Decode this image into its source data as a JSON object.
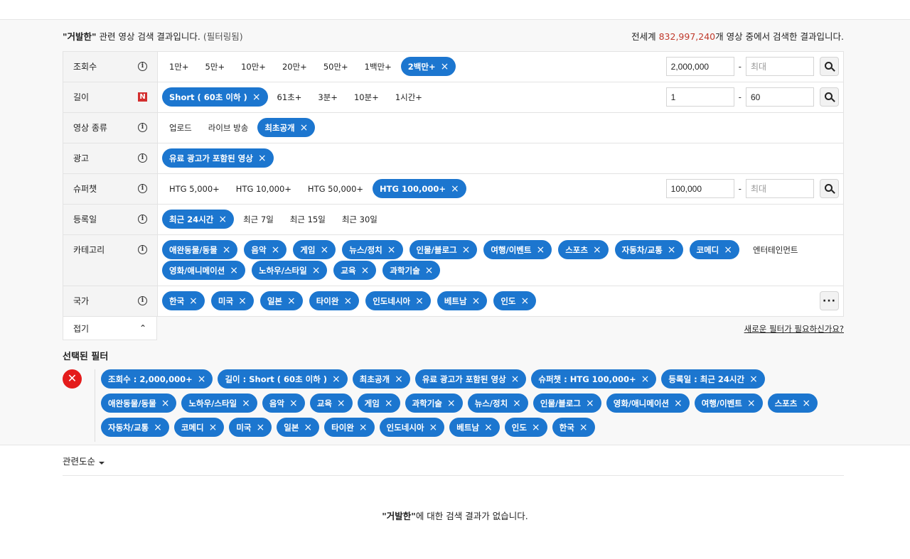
{
  "summary": {
    "query": "\"거발한\"",
    "left_text": " 관련 영상 검색 결과입니다. ",
    "filtered": "(필터링됨)",
    "right_prefix": "전세계 ",
    "total": "832,997,240",
    "right_suffix": "개 영상 중에서 검색한 결과입니다."
  },
  "rows": {
    "views": {
      "label": "조회수",
      "options": [
        "1만+",
        "5만+",
        "10만+",
        "20만+",
        "50만+",
        "1백만+"
      ],
      "active": "2백만+",
      "min_value": "2,000,000",
      "max_placeholder": "최대"
    },
    "length": {
      "label": "길이",
      "active": "Short ( 60초 이하 )",
      "options": [
        "61초+",
        "3분+",
        "10분+",
        "1시간+"
      ],
      "min_value": "1",
      "max_value": "60",
      "badge": "N"
    },
    "type": {
      "label": "영상 종류",
      "options": [
        "업로드",
        "라이브 방송"
      ],
      "active": "최초공개"
    },
    "ads": {
      "label": "광고",
      "active": "유료 광고가 포함된 영상"
    },
    "superchat": {
      "label": "슈퍼챗",
      "options": [
        "HTG 5,000+",
        "HTG 10,000+",
        "HTG 50,000+"
      ],
      "active": "HTG 100,000+",
      "min_value": "100,000",
      "max_placeholder": "최대"
    },
    "upload": {
      "label": "등록일",
      "active": "최근 24시간",
      "options": [
        "최근 7일",
        "최근 15일",
        "최근 30일"
      ]
    },
    "category": {
      "label": "카테고리",
      "line1": [
        "애완동물/동물",
        "음악",
        "게임",
        "뉴스/정치",
        "인물/블로그",
        "여행/이벤트",
        "스포츠",
        "자동차/교통",
        "코메디"
      ],
      "plain": "엔터테인먼트",
      "line2": [
        "영화/애니메이션",
        "노하우/스타일",
        "교육",
        "과학기술"
      ]
    },
    "country": {
      "label": "국가",
      "active": [
        "한국",
        "미국",
        "일본",
        "타이완",
        "인도네시아",
        "베트남",
        "인도"
      ],
      "more": "···"
    }
  },
  "collapse": {
    "label": "접기",
    "chevron": "⌃"
  },
  "new_filter_link": "새로운 필터가 필요하신가요?",
  "selected": {
    "title": "선택된 필터",
    "reset": "✕",
    "chips": [
      "조회수 : 2,000,000+",
      "길이 : Short ( 60초 이하 )",
      "최초공개",
      "유료 광고가 포함된 영상",
      "슈퍼챗 : HTG 100,000+",
      "등록일 : 최근 24시간",
      "애완동물/동물",
      "노하우/스타일",
      "음악",
      "교육",
      "게임",
      "과학기술",
      "뉴스/정치",
      "인물/블로그",
      "영화/애니메이션",
      "여행/이벤트",
      "스포츠",
      "자동차/교통",
      "코메디",
      "미국",
      "일본",
      "타이완",
      "인도네시아",
      "베트남",
      "인도",
      "한국"
    ]
  },
  "sort": {
    "label": "관련도순"
  },
  "no_result": {
    "query": "\"거발한\"",
    "text": "에 대한 검색 결과가 없습니다."
  },
  "chip_close": "×",
  "range_dash": "-",
  "colors": {
    "accent": "#1c76cf",
    "danger": "#e41c1c",
    "highlight": "#c0392b"
  }
}
